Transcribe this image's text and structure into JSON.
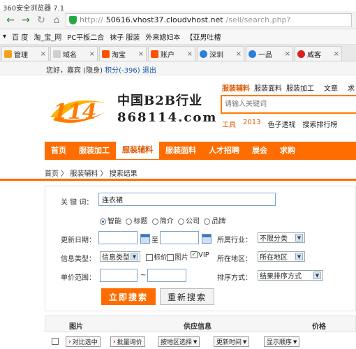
{
  "browser": {
    "title": "360安全浏览器 7.1",
    "url_prefix": "http://",
    "url_domain": "50616.vhost37.cloudvhost.net",
    "url_path": "/sell/search.php?",
    "bookmarks": [
      "百 度",
      "淘_宝_网",
      "PC平板二合",
      "袜子 服装",
      "外来媳妇本",
      "【亚男吐槽"
    ],
    "tabs": [
      {
        "label": "管理",
        "color": "#f4a21a"
      },
      {
        "label": "域名",
        "color": "#cfcfcf"
      },
      {
        "label": "淘宝",
        "color": "#ff5000"
      },
      {
        "label": "账户",
        "color": "#ff5000"
      },
      {
        "label": "深圳",
        "color": "#2d7de0"
      },
      {
        "label": "一品",
        "color": "#2d7de0"
      },
      {
        "label": "威客",
        "color": "#d92020"
      }
    ]
  },
  "site": {
    "greeting": "您好，嘉宾 (隐身)",
    "points": "积分(-396)",
    "logout": "退出",
    "logo_number": "114",
    "logo_title": "中国B2B行业",
    "logo_domain": "868114.com",
    "category_tabs": [
      "服装辅料",
      "服装面料",
      "服装加工",
      "文章",
      "求"
    ],
    "search_placeholder": "请输入关键词",
    "hot_links": [
      "工具",
      "2013",
      "色子透视",
      "搜索排行榜"
    ],
    "nav": [
      "首页",
      "服装加工",
      "服装辅料",
      "服装面料",
      "人才招聘",
      "展会",
      "求购"
    ],
    "breadcrumb": "首页 〉 服装辅料 〉 搜索结果"
  },
  "form": {
    "keyword_label": "关 键 词：",
    "keyword_value": "连衣裙",
    "scopes": [
      "智能",
      "标题",
      "简介",
      "公司",
      "品牌"
    ],
    "date_label": "更新日期：",
    "date_sep": "至",
    "industry_label": "所属行业：",
    "industry_value": "不限分类",
    "type_label": "信息类型：",
    "type_value": "信息类型",
    "price_chk": "标价",
    "image_chk": "图片",
    "vip_chk": "VIP",
    "region_label": "所在地区：",
    "region_value": "所在地区",
    "price_range_label": "单价范围：",
    "price_sep": "~",
    "sort_label": "排序方式：",
    "sort_value": "结果排序方式",
    "submit": "立即搜索",
    "reset": "重新搜索"
  },
  "results": {
    "col_image": "图片",
    "col_supply": "供应信息",
    "col_price": "价格",
    "compare": "对比选中",
    "inquiry": "批量询价",
    "region_select": "按地区选择",
    "time_select": "更新时间",
    "order_select": "显示顺序"
  }
}
